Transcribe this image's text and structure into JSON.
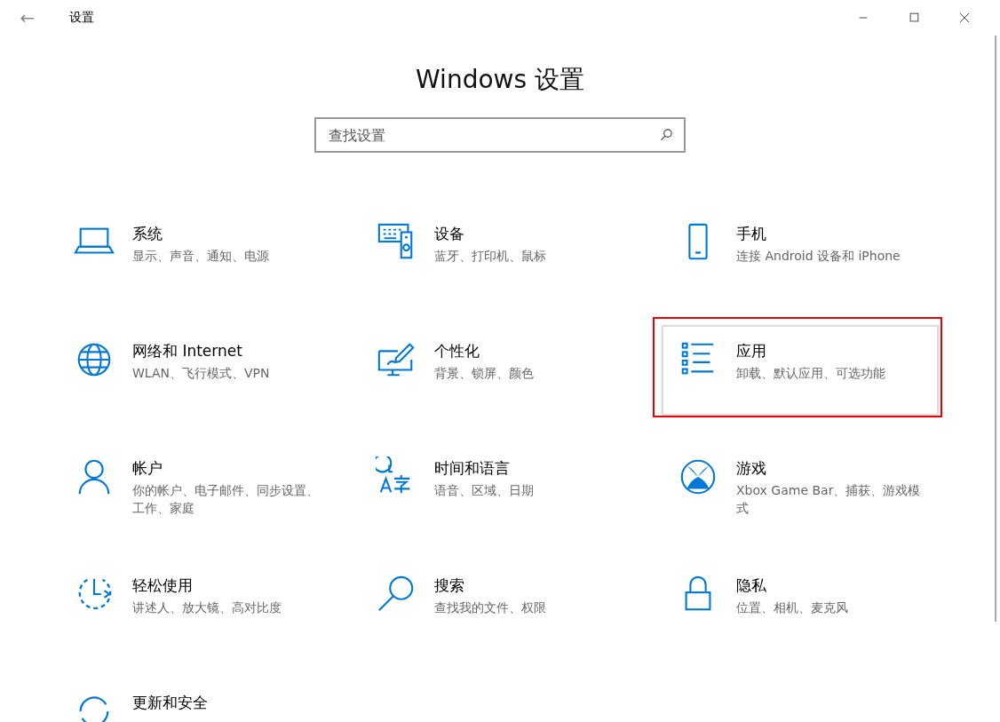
{
  "window": {
    "title": "设置",
    "back": "←",
    "controls": [
      {
        "kind": "minimize"
      },
      {
        "kind": "maximize"
      },
      {
        "kind": "close"
      }
    ]
  },
  "heading": "Windows 设置",
  "search": {
    "placeholder": "查找设置"
  },
  "tiles": [
    {
      "kind": "laptop",
      "name": "系统",
      "description": "显示、声音、通知、电源",
      "highlighted": false
    },
    {
      "kind": "keyboard",
      "name": "设备",
      "description": "蓝牙、打印机、鼠标",
      "highlighted": false
    },
    {
      "kind": "phone",
      "name": "手机",
      "description": "连接 Android 设备和 iPhone",
      "highlighted": false
    },
    {
      "kind": "globe",
      "name": "网络和 Internet",
      "description": "WLAN、飞行模式、VPN",
      "highlighted": false
    },
    {
      "kind": "brush",
      "name": "个性化",
      "description": "背景、锁屏、颜色",
      "highlighted": false
    },
    {
      "kind": "list",
      "name": "应用",
      "description": "卸载、默认应用、可选功能",
      "highlighted": true
    },
    {
      "kind": "person",
      "name": "帐户",
      "description": "你的帐户、电子邮件、同步设置、工作、家庭",
      "highlighted": false
    },
    {
      "kind": "language",
      "name": "时间和语言",
      "description": "语音、区域、日期",
      "highlighted": false
    },
    {
      "kind": "xbox",
      "name": "游戏",
      "description": "Xbox Game Bar、捕获、游戏模式",
      "highlighted": false
    },
    {
      "kind": "ease",
      "name": "轻松使用",
      "description": "讲述人、放大镜、高对比度",
      "highlighted": false
    },
    {
      "kind": "search",
      "name": "搜索",
      "description": "查找我的文件、权限",
      "highlighted": false
    },
    {
      "kind": "lock",
      "name": "隐私",
      "description": "位置、相机、麦克风",
      "highlighted": false
    },
    {
      "kind": "update",
      "name": "更新和安全",
      "highlighted": false
    }
  ]
}
